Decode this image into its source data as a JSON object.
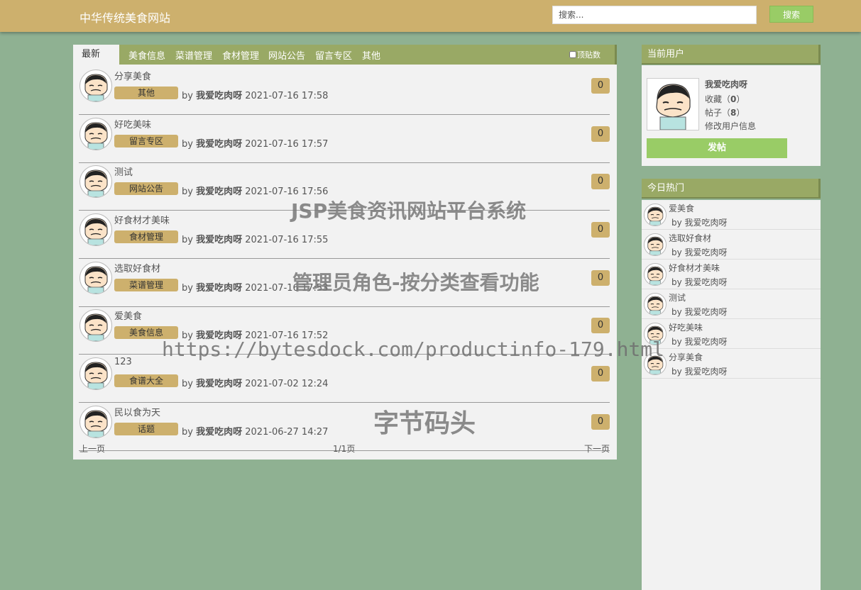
{
  "header": {
    "site_title": "中华传统美食网站",
    "search_placeholder": "搜索...",
    "search_button": "搜索"
  },
  "tabs": [
    {
      "label": "最新",
      "active": true
    },
    {
      "label": "美食信息"
    },
    {
      "label": "菜谱管理"
    },
    {
      "label": "食材管理"
    },
    {
      "label": "网站公告"
    },
    {
      "label": "留言专区"
    },
    {
      "label": "其他"
    }
  ],
  "top_filter_label": "顶贴数",
  "posts": [
    {
      "title": "分享美食",
      "category": "其他",
      "by": "by",
      "author": "我爱吃肉呀",
      "time": "2021-07-16 17:58",
      "count": "0"
    },
    {
      "title": "好吃美味",
      "category": "留言专区",
      "by": "by",
      "author": "我爱吃肉呀",
      "time": "2021-07-16 17:57",
      "count": "0"
    },
    {
      "title": "测试",
      "category": "网站公告",
      "by": "by",
      "author": "我爱吃肉呀",
      "time": "2021-07-16 17:56",
      "count": "0"
    },
    {
      "title": "好食材才美味",
      "category": "食材管理",
      "by": "by",
      "author": "我爱吃肉呀",
      "time": "2021-07-16 17:55",
      "count": "0"
    },
    {
      "title": "选取好食材",
      "category": "菜谱管理",
      "by": "by",
      "author": "我爱吃肉呀",
      "time": "2021-07-16 17:53",
      "count": "0"
    },
    {
      "title": "爱美食",
      "category": "美食信息",
      "by": "by",
      "author": "我爱吃肉呀",
      "time": "2021-07-16 17:52",
      "count": "0"
    },
    {
      "title": "123",
      "category": "食谱大全",
      "by": "by",
      "author": "我爱吃肉呀",
      "time": "2021-07-02 12:24",
      "count": "0"
    },
    {
      "title": "民以食为天",
      "category": "话题",
      "by": "by",
      "author": "我爱吃肉呀",
      "time": "2021-06-27 14:27",
      "count": "0"
    }
  ],
  "pager": {
    "prev": "上一页",
    "info": "1/1页",
    "next": "下一页"
  },
  "current_user": {
    "heading": "当前用户",
    "name": "我爱吃肉呀",
    "favorites_label": "收藏",
    "favorites": "0",
    "posts_label": "帖子",
    "posts": "8",
    "edit_link": "修改用户信息",
    "post_button": "发帖"
  },
  "hot": {
    "heading": "今日热门",
    "items": [
      {
        "title": "爱美食",
        "by": "by 我爱吃肉呀"
      },
      {
        "title": "选取好食材",
        "by": "by 我爱吃肉呀"
      },
      {
        "title": "好食材才美味",
        "by": "by 我爱吃肉呀"
      },
      {
        "title": "测试",
        "by": "by 我爱吃肉呀"
      },
      {
        "title": "好吃美味",
        "by": "by 我爱吃肉呀"
      },
      {
        "title": "分享美食",
        "by": "by 我爱吃肉呀"
      }
    ]
  },
  "watermarks": {
    "line1": "JSP美食资讯网站平台系统",
    "line2": "管理员角色-按分类查看功能",
    "line3": "https://bytesdock.com/productinfo-179.html",
    "line4": "字节码头"
  },
  "colors": {
    "background": "#8fb192",
    "header": "#cdb06d",
    "tabbar": "#99a965",
    "badge": "#cdb06d",
    "button_green": "#99cc66"
  }
}
